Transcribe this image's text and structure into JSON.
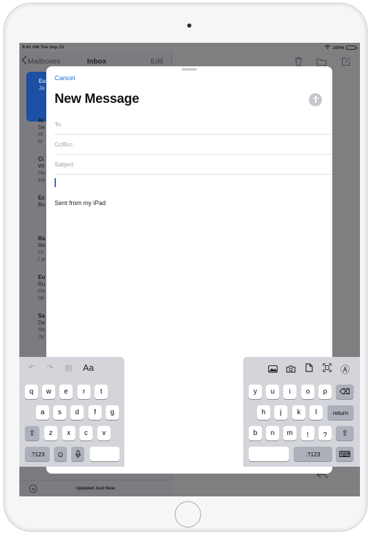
{
  "device": {
    "name": "iPad"
  },
  "status_bar": {
    "time": "9:41 AM  Tue Sep 15",
    "battery": "100%",
    "battery_level": 1.0
  },
  "mail_list": {
    "back_label": "Mailboxes",
    "title": "Inbox",
    "edit_label": "Edit",
    "rows": [
      {
        "sender": "Eu",
        "line2": "Ja",
        "line3": ""
      },
      {
        "sender": "Ar",
        "line2": "Se",
        "line3": "Hi",
        "line4": "to"
      },
      {
        "sender": "Ci",
        "line2": "Wi",
        "line3": "He",
        "line4": "ins"
      },
      {
        "sender": "Ec",
        "line2": "Bo",
        "line3": "",
        "line4": ""
      },
      {
        "sender": "Ra",
        "line2": "Re",
        "line3": "I'v",
        "line4": "I w"
      },
      {
        "sender": "Eu",
        "line2": "Ru",
        "line3": "He",
        "line4": "tal"
      },
      {
        "sender": "Sa",
        "line2": "De",
        "line3": "He",
        "line4": "Ju"
      }
    ],
    "footer_status": "Updated Just Now"
  },
  "compose": {
    "cancel_label": "Cancel",
    "title": "New Message",
    "fields": {
      "to": "To:",
      "cc_bcc": "Cc/Bcc:",
      "subject": "Subject:"
    },
    "signature": "Sent from my iPad"
  },
  "keyboard": {
    "left": {
      "toolbar": {
        "undo": "↶",
        "redo": "↷",
        "paste": "▤",
        "format": "Aa"
      },
      "row1": [
        "q",
        "w",
        "e",
        "r",
        "t"
      ],
      "row2": [
        "a",
        "s",
        "d",
        "f",
        "g"
      ],
      "row3": [
        "z",
        "x",
        "c",
        "v"
      ],
      "shift": "⇧",
      "numbers": ".?123",
      "emoji": "☺",
      "mic": "🎙"
    },
    "right": {
      "row1": [
        "y",
        "u",
        "i",
        "o",
        "p"
      ],
      "row2": [
        "h",
        "j",
        "k",
        "l"
      ],
      "row3": [
        "b",
        "n",
        "m"
      ],
      "exclaim": "!",
      "exclaim_hint": ",",
      "question": "?",
      "question_hint": ".",
      "delete": "⌫",
      "return": "return",
      "shift": "⇧",
      "numbers": ".?123",
      "hide": "⌨",
      "markup": "Ⓐ"
    }
  },
  "colors": {
    "accent": "#1f6fd9",
    "selected_row": "#1d4fa5",
    "keyboard_bg": "#d3d5db"
  }
}
